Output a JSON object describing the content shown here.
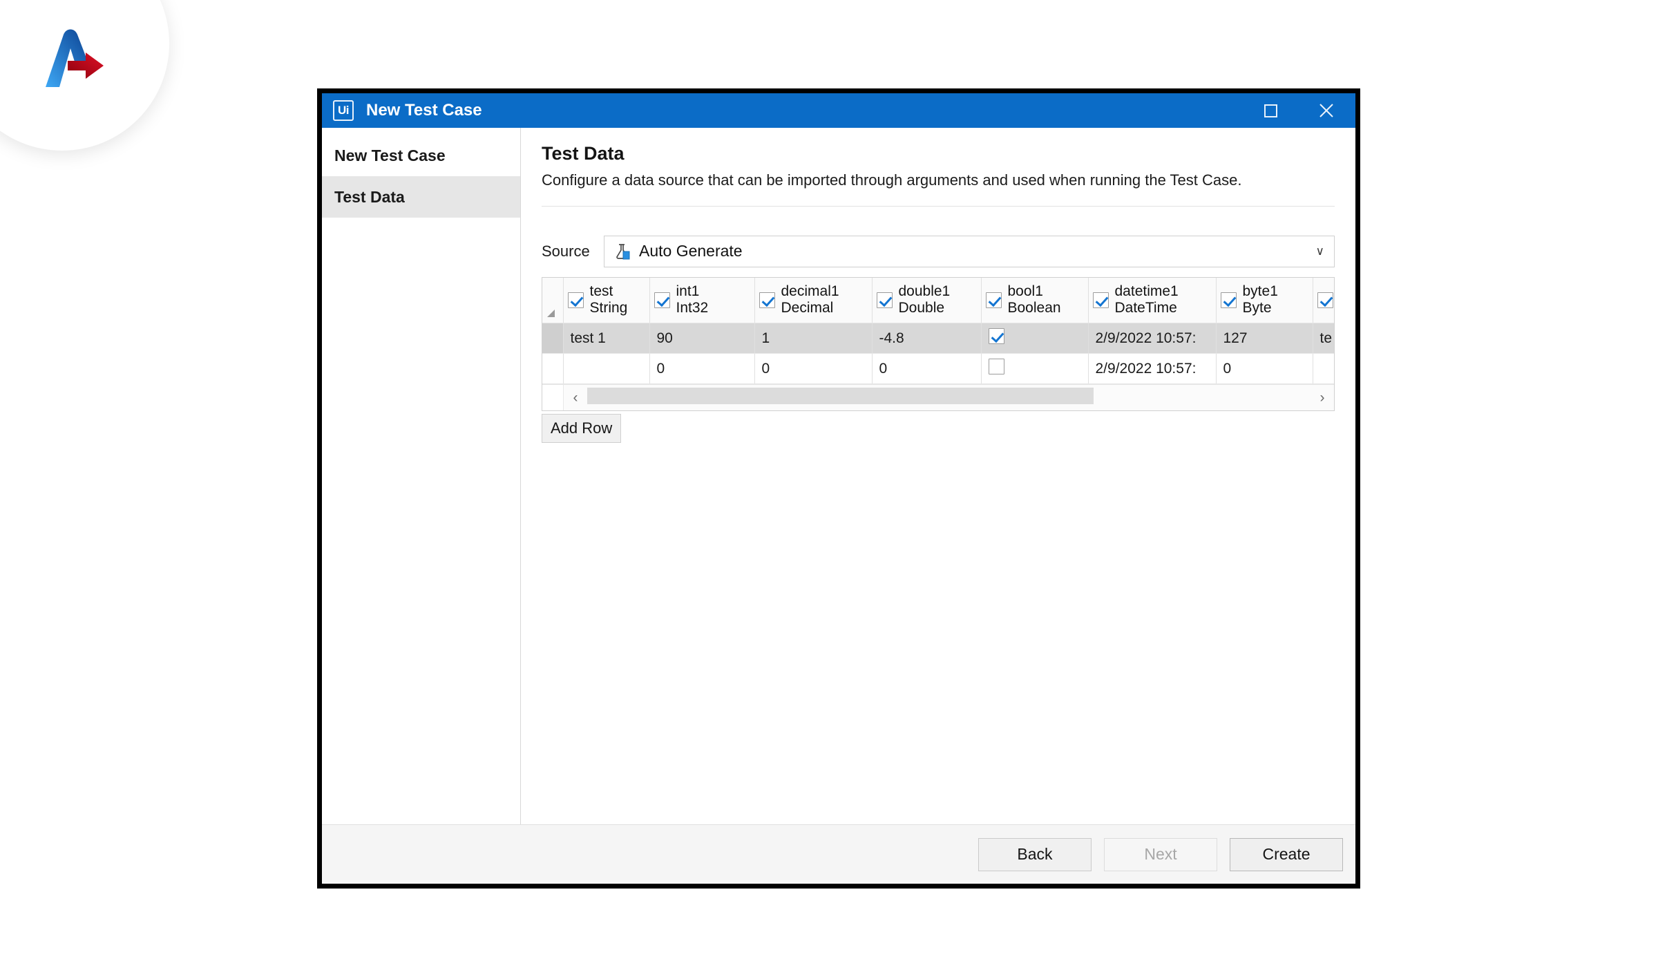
{
  "brand": {
    "logo_name": "brand-logo-chevron-arrow",
    "blue": "#1a73d9",
    "red": "#c20017"
  },
  "window": {
    "app_icon_label": "Ui",
    "title": "New Test Case",
    "titlebar_color": "#0b6cc7",
    "maximize_label": "Maximize",
    "close_label": "Close"
  },
  "sidenav": {
    "items": [
      {
        "label": "New Test Case",
        "active": false
      },
      {
        "label": "Test Data",
        "active": true
      }
    ]
  },
  "content": {
    "title": "Test Data",
    "description": "Configure a data source that can be imported through arguments and used when running the Test Case."
  },
  "source": {
    "label": "Source",
    "icon_name": "flask-document-icon",
    "value": "Auto Generate",
    "caret": "∨"
  },
  "grid": {
    "select_all_name": "select-all-corner",
    "columns": [
      {
        "name": "test",
        "type": "String",
        "checked": true
      },
      {
        "name": "int1",
        "type": "Int32",
        "checked": true
      },
      {
        "name": "decimal1",
        "type": "Decimal",
        "checked": true
      },
      {
        "name": "double1",
        "type": "Double",
        "checked": true
      },
      {
        "name": "bool1",
        "type": "Boolean",
        "checked": true
      },
      {
        "name": "datetime1",
        "type": "DateTime",
        "checked": true
      },
      {
        "name": "byte1",
        "type": "Byte",
        "checked": true
      },
      {
        "name": "",
        "type": "",
        "checked": true
      }
    ],
    "rows": [
      {
        "selected": true,
        "cells": [
          "test 1",
          "90",
          "1",
          "-4.8",
          "",
          "2/9/2022 10:57:",
          "127",
          "te"
        ],
        "bool_checked": true
      },
      {
        "selected": false,
        "cells": [
          "",
          "0",
          "0",
          "0",
          "",
          "2/9/2022 10:57:",
          "0",
          ""
        ],
        "bool_checked": false
      }
    ],
    "scroll_left_label": "‹",
    "scroll_right_label": "›"
  },
  "actions": {
    "add_row_label": "Add Row"
  },
  "footer": {
    "buttons": [
      {
        "label": "Back",
        "disabled": false
      },
      {
        "label": "Next",
        "disabled": true
      },
      {
        "label": "Create",
        "disabled": false
      }
    ]
  }
}
